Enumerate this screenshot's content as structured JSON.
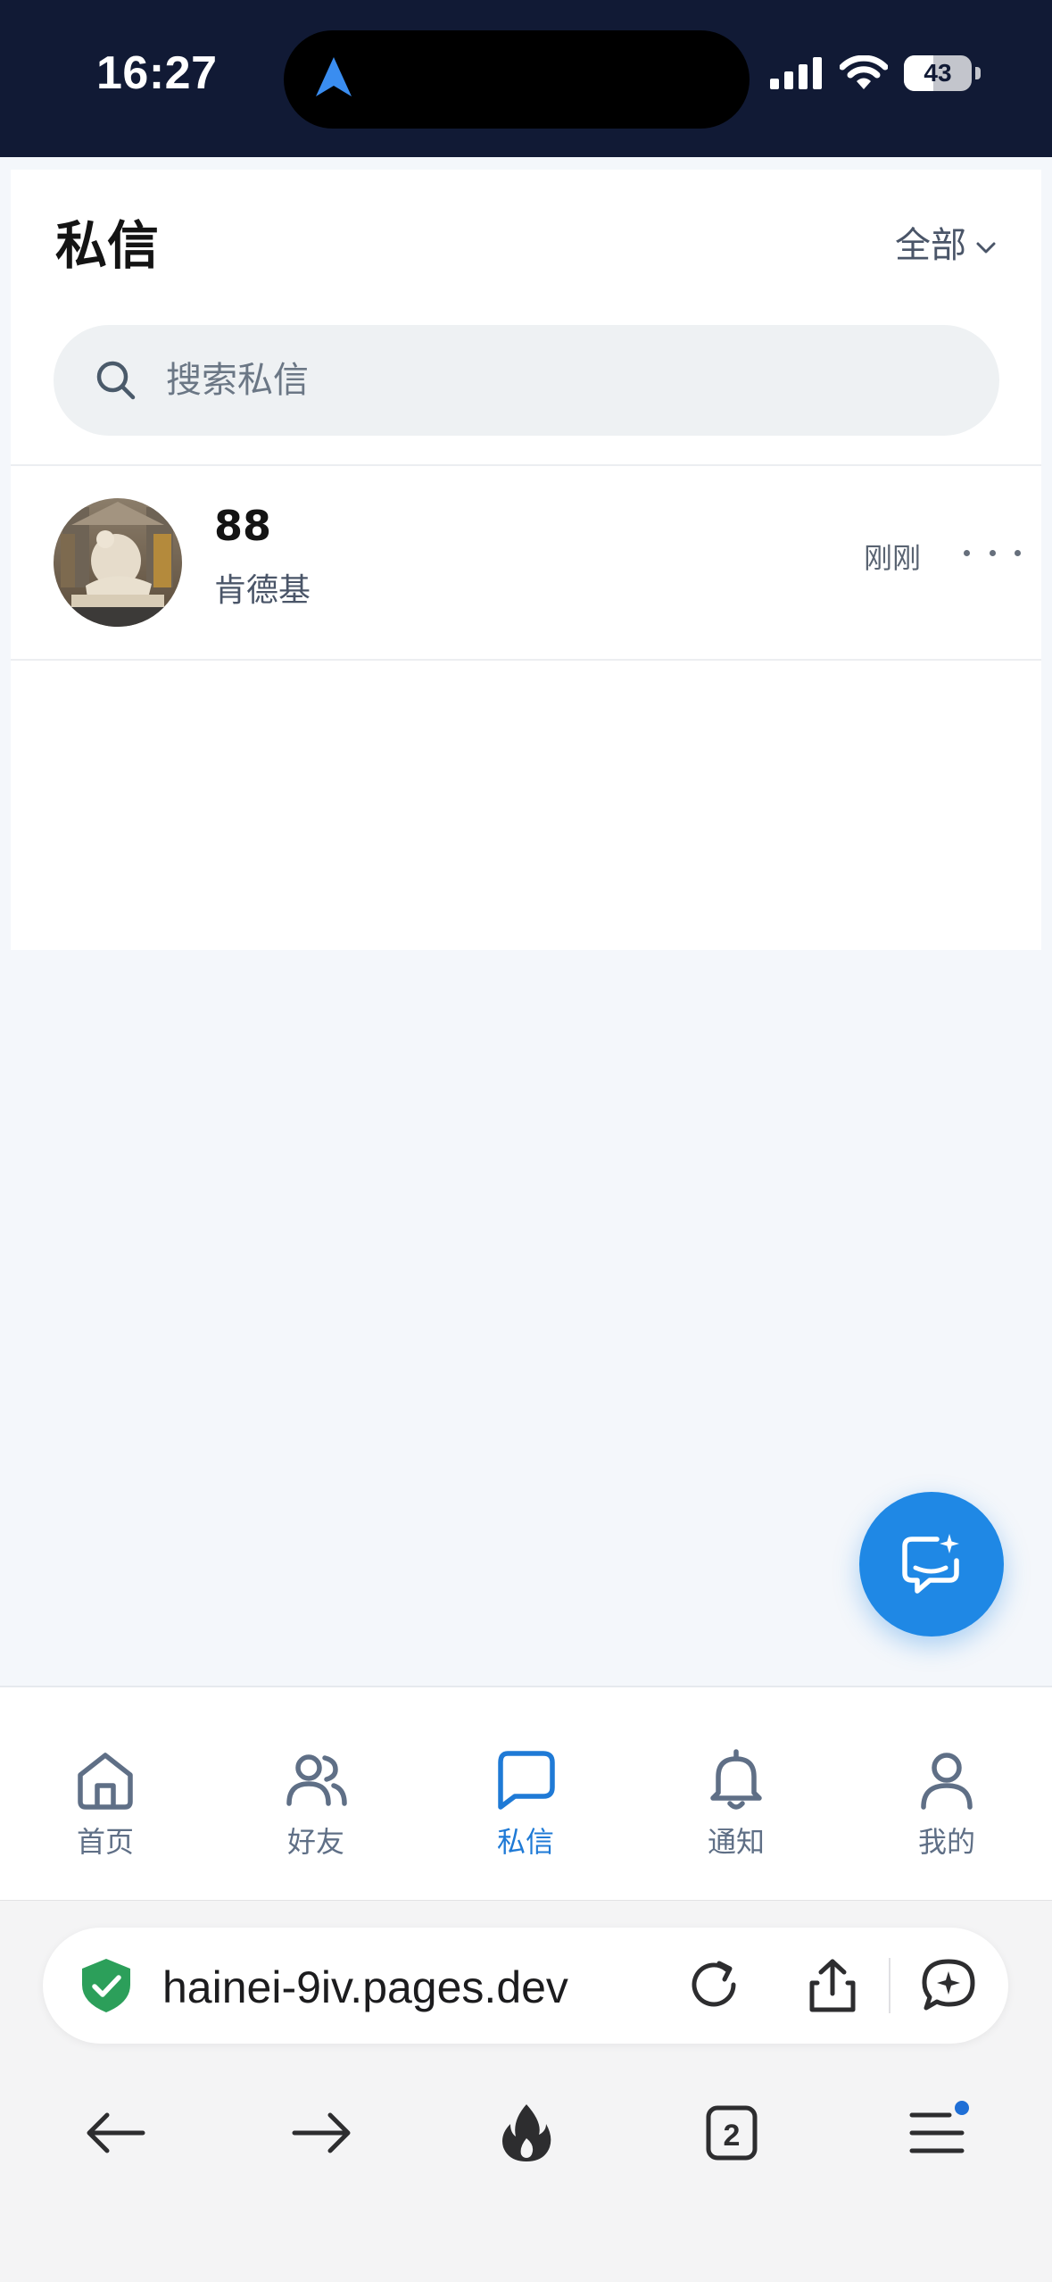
{
  "status_bar": {
    "time": "16:27",
    "battery": "43",
    "battery_level": 0.43,
    "icons": [
      "location-arrow-icon",
      "cellular-signal-icon",
      "wifi-icon",
      "battery-icon"
    ]
  },
  "header": {
    "title": "私信",
    "filter_label": "全部"
  },
  "search": {
    "placeholder": "搜索私信",
    "value": ""
  },
  "conversations": [
    {
      "name": "88",
      "preview": "肯德基",
      "time": "刚刚",
      "avatar": "statue-photo"
    }
  ],
  "fab": {
    "icon": "new-message-icon"
  },
  "tabs": [
    {
      "label": "首页",
      "icon": "home-icon",
      "active": false
    },
    {
      "label": "好友",
      "icon": "friends-icon",
      "active": false
    },
    {
      "label": "私信",
      "icon": "chat-icon",
      "active": true
    },
    {
      "label": "通知",
      "icon": "bell-icon",
      "active": false
    },
    {
      "label": "我的",
      "icon": "user-icon",
      "active": false
    }
  ],
  "browser": {
    "url": "hainei-9iv.pages.dev",
    "tab_count": "2"
  },
  "colors": {
    "accent": "#1f88e5",
    "status_bar_bg": "#111a35",
    "page_bg": "#f4f7fb",
    "active_tab": "#1f7ad6",
    "inactive_tab": "#5f6f86",
    "secure_green": "#2c9f5a"
  }
}
